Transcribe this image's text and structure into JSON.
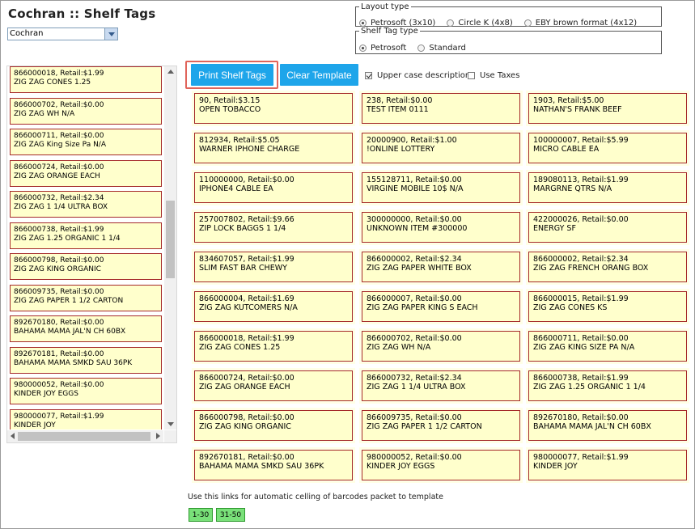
{
  "header": {
    "title": "Cochran :: Shelf Tags"
  },
  "store_select": {
    "value": "Cochran"
  },
  "layout_type": {
    "legend": "Layout type",
    "options": [
      {
        "label": "Petrosoft (3x10)",
        "selected": true
      },
      {
        "label": "Circle K (4x8)",
        "selected": false
      },
      {
        "label": "EBY brown format (4x12)",
        "selected": false
      }
    ]
  },
  "shelf_tag_type": {
    "legend": "Shelf Tag type",
    "options": [
      {
        "label": "Petrosoft",
        "selected": true
      },
      {
        "label": "Standard",
        "selected": false
      }
    ]
  },
  "toolbar": {
    "print_label": "Print Shelf Tags",
    "clear_label": "Clear Template",
    "upper_case_label": "Upper case description",
    "upper_case_checked": true,
    "use_taxes_label": "Use Taxes",
    "use_taxes_checked": false
  },
  "item_list": [
    {
      "line1": "866000018,  Retail:$1.99",
      "line2": "ZIG ZAG CONES 1.25"
    },
    {
      "line1": "866000702,  Retail:$0.00",
      "line2": "ZIG ZAG WH N/A"
    },
    {
      "line1": "866000711,  Retail:$0.00",
      "line2": "ZIG ZAG King Size Pa N/A"
    },
    {
      "line1": "866000724,  Retail:$0.00",
      "line2": "ZIG ZAG ORANGE EACH"
    },
    {
      "line1": "866000732,  Retail:$2.34",
      "line2": "ZIG ZAG 1 1/4 ULTRA BOX"
    },
    {
      "line1": "866000738,  Retail:$1.99",
      "line2": "ZIG ZAG 1.25 ORGANIC 1 1/4"
    },
    {
      "line1": "866000798,  Retail:$0.00",
      "line2": "ZIG ZAG KING ORGANIC"
    },
    {
      "line1": "866009735,  Retail:$0.00",
      "line2": "ZIG ZAG PAPER 1 1/2 CARTON"
    },
    {
      "line1": "892670180,  Retail:$0.00",
      "line2": "BAHAMA MAMA JAL'N CH 60BX"
    },
    {
      "line1": "892670181,  Retail:$0.00",
      "line2": "BAHAMA MAMA SMKD SAU 36PK"
    },
    {
      "line1": "980000052,  Retail:$0.00",
      "line2": "KINDER JOY EGGS"
    },
    {
      "line1": "980000077,  Retail:$1.99",
      "line2": "KINDER JOY"
    }
  ],
  "template_tags": [
    {
      "line1": "90,  Retail:$3.15",
      "line2": "OPEN TOBACCO"
    },
    {
      "line1": "238,  Retail:$0.00",
      "line2": "TEST ITEM 0111"
    },
    {
      "line1": "1903,  Retail:$5.00",
      "line2": "NATHAN'S FRANK BEEF"
    },
    {
      "line1": "812934,  Retail:$5.05",
      "line2": "WARNER IPHONE CHARGE"
    },
    {
      "line1": "20000900,  Retail:$1.00",
      "line2": "!ONLINE LOTTERY"
    },
    {
      "line1": "100000007,  Retail:$5.99",
      "line2": "MICRO CABLE EA"
    },
    {
      "line1": "110000000,  Retail:$0.00",
      "line2": "IPHONE4 CABLE EA"
    },
    {
      "line1": "155128711,  Retail:$0.00",
      "line2": "VIRGINE MOBILE 10$ N/A"
    },
    {
      "line1": "189080113,  Retail:$1.99",
      "line2": "MARGRNE QTRS N/A"
    },
    {
      "line1": "257007802,  Retail:$9.66",
      "line2": "ZIP LOCK BAGGS 1 1/4"
    },
    {
      "line1": "300000000,  Retail:$0.00",
      "line2": "UNKNOWN ITEM #300000"
    },
    {
      "line1": "422000026,  Retail:$0.00",
      "line2": "ENERGY SF"
    },
    {
      "line1": "834607057,  Retail:$1.99",
      "line2": "SLIM FAST BAR CHEWY"
    },
    {
      "line1": "866000002,  Retail:$2.34",
      "line2": "ZIG ZAG PAPER WHITE BOX"
    },
    {
      "line1": "866000002,  Retail:$2.34",
      "line2": "ZIG ZAG FRENCH ORANG BOX"
    },
    {
      "line1": "866000004,  Retail:$1.69",
      "line2": "ZIG ZAG KUTCOMERS N/A"
    },
    {
      "line1": "866000007,  Retail:$0.00",
      "line2": "ZIG ZAG PAPER KING S EACH"
    },
    {
      "line1": "866000015,  Retail:$1.99",
      "line2": "ZIG ZAG CONES KS"
    },
    {
      "line1": "866000018,  Retail:$1.99",
      "line2": "ZIG ZAG CONES 1.25"
    },
    {
      "line1": "866000702,  Retail:$0.00",
      "line2": "ZIG ZAG WH N/A"
    },
    {
      "line1": "866000711,  Retail:$0.00",
      "line2": "ZIG ZAG KING SIZE PA N/A"
    },
    {
      "line1": "866000724,  Retail:$0.00",
      "line2": "ZIG ZAG ORANGE EACH"
    },
    {
      "line1": "866000732,  Retail:$2.34",
      "line2": "ZIG ZAG 1 1/4 ULTRA BOX"
    },
    {
      "line1": "866000738,  Retail:$1.99",
      "line2": "ZIG ZAG 1.25 ORGANIC 1 1/4"
    },
    {
      "line1": "866000798,  Retail:$0.00",
      "line2": "ZIG ZAG KING ORGANIC"
    },
    {
      "line1": "866009735,  Retail:$0.00",
      "line2": "ZIG ZAG PAPER 1 1/2 CARTON"
    },
    {
      "line1": "892670180,  Retail:$0.00",
      "line2": "BAHAMA MAMA JAL'N CH 60BX"
    },
    {
      "line1": "892670181,  Retail:$0.00",
      "line2": "BAHAMA MAMA SMKD SAU 36PK"
    },
    {
      "line1": "980000052,  Retail:$0.00",
      "line2": "KINDER JOY EGGS"
    },
    {
      "line1": "980000077,  Retail:$1.99",
      "line2": "KINDER JOY"
    }
  ],
  "footer": {
    "note": "Use this links for automatic celling of barcodes packet to template",
    "links": [
      "1-30",
      "31-50"
    ]
  },
  "colors": {
    "tag_background": "#ffffcc",
    "tag_border": "#a52a2a",
    "button_blue": "#1ea5ea",
    "link_green": "#79e079",
    "highlight_red": "#e0645a"
  }
}
